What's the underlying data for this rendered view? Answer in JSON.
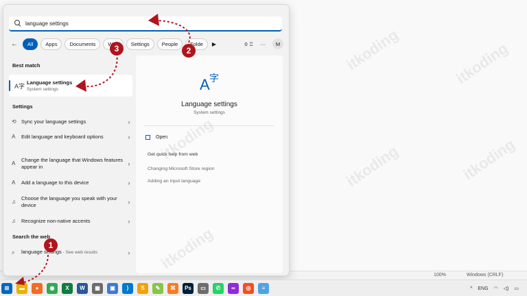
{
  "search": {
    "value": "language settings"
  },
  "filters": {
    "chips": [
      "All",
      "Apps",
      "Documents",
      "Web",
      "Settings",
      "People",
      "Folde"
    ],
    "points": "0",
    "more": "···",
    "avatar": "M"
  },
  "left": {
    "best_match_header": "Best match",
    "best_match": {
      "title": "Language settings",
      "subtitle": "System settings"
    },
    "settings_header": "Settings",
    "settings_items": [
      {
        "label": "Sync your language settings"
      },
      {
        "label": "Edit language and keyboard options"
      },
      {
        "label": "Change the language that Windows features appear in"
      },
      {
        "label": "Add a language to this device"
      },
      {
        "label": "Choose the language you speak with your device"
      },
      {
        "label": "Recognize non-native accents"
      }
    ],
    "web_header": "Search the web",
    "web_item": {
      "label": "language settings",
      "suffix": " - See web results"
    }
  },
  "preview": {
    "title": "Language settings",
    "subtitle": "System settings",
    "open_label": "Open",
    "quick_help": "Get quick help from web",
    "links": [
      "Changing Microsoft Store region",
      "Adding an input language"
    ]
  },
  "statusbar": {
    "zoom": "100%",
    "eol": "Windows (CRLF)"
  },
  "tray": {
    "lang": "ENG"
  },
  "annotations": [
    "1",
    "2",
    "3"
  ],
  "watermark": "itkoding",
  "colors": {
    "accent": "#005fb8",
    "annotation": "#b0141c"
  }
}
